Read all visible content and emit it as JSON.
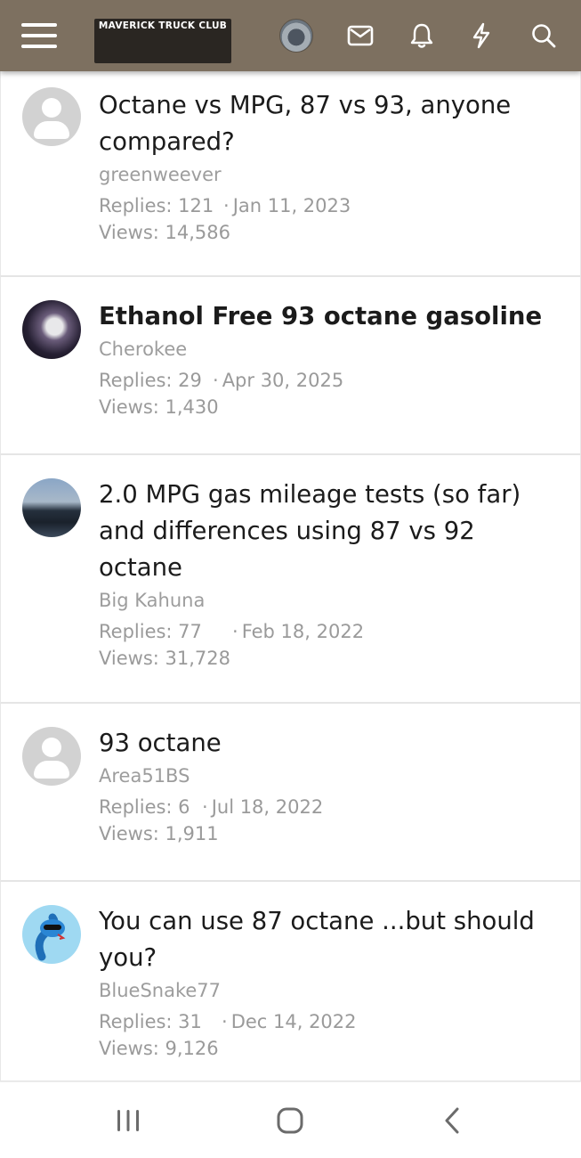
{
  "header": {
    "logo_text": "MAVERICK TRUCK CLUB",
    "icons": [
      "menu-icon",
      "user-avatar",
      "mail-icon",
      "bell-icon",
      "bolt-icon",
      "search-icon"
    ]
  },
  "threads": [
    {
      "title": "Octane vs MPG, 87 vs 93, anyone compared?",
      "author": "greenweever",
      "replies": "Replies: 121",
      "date": "Jan 11, 2023",
      "views": "Views: 14,586",
      "bold": false,
      "avatar": "default-avatar"
    },
    {
      "title": "Ethanol Free 93 octane gasoline",
      "author": "Cherokee",
      "replies": "Replies: 29",
      "date": "Apr 30, 2025",
      "views": "Views: 1,430",
      "bold": true,
      "avatar": "photo-avatar"
    },
    {
      "title": "2.0 MPG gas mileage tests (so far) and differences using 87 vs 92 octane",
      "author": "Big Kahuna",
      "replies": "Replies: 77",
      "date": "Feb 18, 2022",
      "views": "Views: 31,728",
      "bold": false,
      "avatar": "truck-photo-avatar"
    },
    {
      "title": "93 octane",
      "author": "Area51BS",
      "replies": "Replies: 6",
      "date": "Jul 18, 2022",
      "views": "Views: 1,911",
      "bold": false,
      "avatar": "default-avatar"
    },
    {
      "title": "You can use 87 octane ...but should you?",
      "author": "BlueSnake77",
      "replies": "Replies: 31",
      "date": "Dec 14, 2022",
      "views": "Views: 9,126",
      "bold": false,
      "avatar": "snake-avatar"
    }
  ],
  "separator": "·",
  "colors": {
    "header_bg": "#7d7060",
    "title_text": "#1b1b1b",
    "meta_text": "#9a9a9a"
  }
}
